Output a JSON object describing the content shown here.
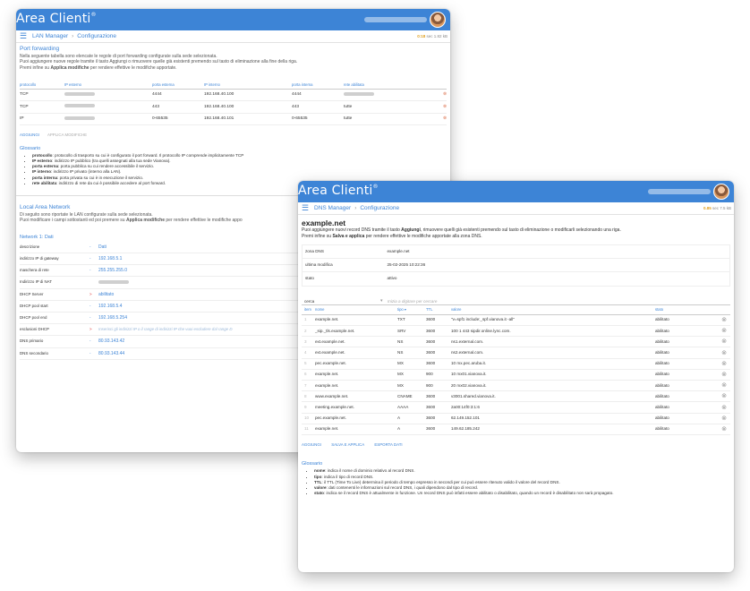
{
  "brand": "Area Clienti",
  "brand_mark": "®",
  "colors": {
    "appbar": "#3d84d6",
    "link": "#3d84d6",
    "timer": "#e0a020",
    "remove": "#e08060"
  },
  "icons": {
    "menu": "hamburger-icon",
    "remove": "remove-circle-icon",
    "avatar": "user-avatar"
  },
  "lan": {
    "breadcrumb": [
      "LAN Manager",
      "Configurazione"
    ],
    "timer": "0:18",
    "timer_unit": "sec 1.82 kB",
    "pf": {
      "title": "Port forwarding",
      "intro1": "Nella seguente tabella sono elencate le regole di port forwarding configurate sulla sede selezionata.",
      "intro2": "Puoi aggiungere nuove regole tramite il tasto Aggiungi o rimuovere quelle già esistenti premendo sul tasto di eliminazione alla fine della riga.",
      "intro3_a": "Premi infine su ",
      "intro3_b": "Applica modifiche",
      "intro3_c": " per rendere effettive le modifiche apportate.",
      "headers": [
        "protocollo",
        "IP esterno",
        "porta esterna",
        "IP interno",
        "porta interna",
        "rete abilitata"
      ],
      "rows": [
        {
          "proto": "TCP",
          "ext_port": "4444",
          "int_ip": "192.168.40.100",
          "int_port": "4444",
          "net": ""
        },
        {
          "proto": "TCP",
          "ext_port": "443",
          "int_ip": "192.168.40.100",
          "int_port": "443",
          "net": "tutte"
        },
        {
          "proto": "IP",
          "ext_port": "0-65535",
          "int_ip": "192.168.40.101",
          "int_port": "0-65535",
          "net": "tutte"
        }
      ],
      "add": "AGGIUNGI",
      "apply": "APPLICA MODIFICHE"
    },
    "gloss": {
      "title": "Glossario",
      "items": [
        {
          "term": "protocollo",
          "desc": ": protocollo di trasporto su cui è configurato il port forward. Il protocollo IP comprende implicitamente TCP"
        },
        {
          "term": "IP esterno",
          "desc": ": indirizzo IP pubblico (tra quelli assegnati alla tua sede Vianova)."
        },
        {
          "term": "porta esterna",
          "desc": ": porta pubblica su cui rendere accessibile il servizio."
        },
        {
          "term": "IP interno",
          "desc": ": indirizzo IP privato (interno alla LAN)."
        },
        {
          "term": "porta interna",
          "desc": ": porta privata su cui è in esecuzione il servizio."
        },
        {
          "term": "rete abilitata",
          "desc": ": indirizzo di rete da cui è possibile accedere al port forward."
        }
      ]
    },
    "lan_section": {
      "title": "Local Area Network",
      "intro1": "Di seguito sono riportate le LAN configurate sulla sede selezionata.",
      "intro2_a": "Puoi modificare i campi sottostanti ed poi premere su ",
      "intro2_b": "Applica modifiche",
      "intro2_c": " per rendere effettive le modifiche appo",
      "network_title": "Network 1: Dati",
      "rows": [
        {
          "label": "descrizione",
          "marker": "-",
          "value": "Dati",
          "placeholder": false
        },
        {
          "label": "indirizzo IP di gateway",
          "marker": "-",
          "value": "192.168.5.1",
          "placeholder": false
        },
        {
          "label": "maschera di rete",
          "marker": "-",
          "value": "255.255.255.0",
          "placeholder": false
        },
        {
          "label": "Indirizzo IP di NAT",
          "marker": "",
          "value": "",
          "placeholder": false
        },
        {
          "label": "DHCP Server",
          "marker": ">",
          "value": "abilitato",
          "placeholder": false
        },
        {
          "label": "DHCP pool start",
          "marker": "-",
          "value": "192.168.5.4",
          "placeholder": false
        },
        {
          "label": "DHCP pool end",
          "marker": "-",
          "value": "192.168.5.254",
          "placeholder": false
        },
        {
          "label": "esclusioni DHCP",
          "marker": ">",
          "value": "Inserisci gli indirizzi IP o il range di indirizzi IP che vuoi escludere dal range D",
          "placeholder": true
        },
        {
          "label": "DNS primario",
          "marker": "-",
          "value": "80.93.143.42",
          "placeholder": false
        },
        {
          "label": "DNS secondario",
          "marker": "-",
          "value": "80.93.143.44",
          "placeholder": false
        }
      ]
    }
  },
  "dns": {
    "breadcrumb": [
      "DNS Manager",
      "Configurazione"
    ],
    "timer": "0.85",
    "timer_unit": "sec 7.5 kB",
    "title": "example.net",
    "intro1_a": "Puoi aggiungere nuovi record DNS tramite il tasto ",
    "intro1_b": "Aggiungi",
    "intro1_c": ", rimuovere quelli già esistenti premendo sul tasto di eliminazione o modificarli selezionando una riga.",
    "intro2_a": "Premi infine su ",
    "intro2_b": "Salva e applica",
    "intro2_c": " per rendere effettive le modifiche apportate alla zona DNS.",
    "zone": [
      {
        "k": "zona DNS",
        "v": "example.net"
      },
      {
        "k": "ultima modifica",
        "v": "25-02-2025 10:22:36"
      },
      {
        "k": "stato",
        "v": "attivo"
      }
    ],
    "search_label": "cerca",
    "search_placeholder": "Inizia a digitare per cercare",
    "headers": [
      "item",
      "nome",
      "tipo ▾",
      "TTL",
      "valore",
      "stato"
    ],
    "records": [
      {
        "idx": "1",
        "name": "example.net.",
        "type": "TXT",
        "ttl": "3600",
        "value": "\"v=spf1 include:_spf.vianova.it -all\"",
        "state": "abilitato"
      },
      {
        "idx": "2",
        "name": "_sip._tls.example.net.",
        "type": "SRV",
        "ttl": "3600",
        "value": "100 1 443 sipdir.online.lync.com.",
        "state": "abilitato"
      },
      {
        "idx": "3",
        "name": "ext.example.net.",
        "type": "NS",
        "ttl": "3600",
        "value": "ns1.external.com.",
        "state": "abilitato"
      },
      {
        "idx": "4",
        "name": "ext.example.net.",
        "type": "NS",
        "ttl": "3600",
        "value": "ns2.external.com.",
        "state": "abilitato"
      },
      {
        "idx": "5",
        "name": "pec.example.net.",
        "type": "MX",
        "ttl": "3600",
        "value": "10 mx.pec.aruba.it.",
        "state": "abilitato"
      },
      {
        "idx": "6",
        "name": "example.net.",
        "type": "MX",
        "ttl": "900",
        "value": "10 mx01.vianova.it.",
        "state": "abilitato"
      },
      {
        "idx": "7",
        "name": "example.net.",
        "type": "MX",
        "ttl": "900",
        "value": "20 mx02.vianova.it.",
        "state": "abilitato"
      },
      {
        "idx": "8",
        "name": "www.example.net.",
        "type": "CNAME",
        "ttl": "3600",
        "value": "v3001.shared.vianova.it.",
        "state": "abilitato"
      },
      {
        "idx": "9",
        "name": "meeting.example.net.",
        "type": "AAAA",
        "ttl": "3600",
        "value": "2a00:14f0:3:1:6",
        "state": "abilitato"
      },
      {
        "idx": "10",
        "name": "pec.example.net.",
        "type": "A",
        "ttl": "3600",
        "value": "62.149.152.101",
        "state": "abilitato"
      },
      {
        "idx": "11",
        "name": "example.net.",
        "type": "A",
        "ttl": "3600",
        "value": "149.62.185.242",
        "state": "abilitato"
      }
    ],
    "buttons": {
      "add": "AGGIUNGI",
      "save": "SALVA E APPLICA",
      "export": "ESPORTA DATI"
    },
    "gloss": {
      "title": "Glossario",
      "items": [
        {
          "term": "nome",
          "desc": ": indica il nome di dominio relativo al record DNS."
        },
        {
          "term": "tipo",
          "desc": ": indica il tipo di record DNS."
        },
        {
          "term": "TTL",
          "desc": ": il TTL (Time To Live) determina il periodo di tempo espresso in secondi per cui può essere ritenuto valido il valore del record DNS."
        },
        {
          "term": "valore",
          "desc": ": dati contenenti le informazioni sul record DNS, i quali dipendono dal tipo di record."
        },
        {
          "term": "stato",
          "desc": ": indica se il record DNS è attualmente in funzione. Un record DNS può infatti essere abilitato o disabilitato, quando un record è disabilitato non sarà propagato."
        }
      ]
    }
  }
}
